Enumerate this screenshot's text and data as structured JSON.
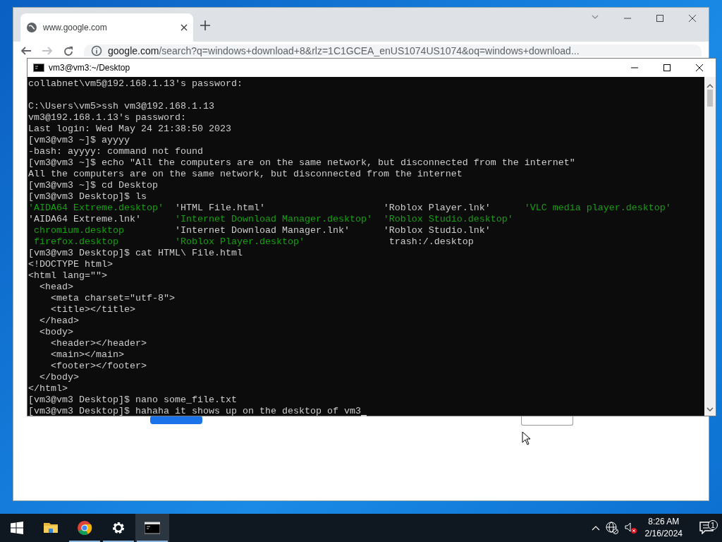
{
  "browser": {
    "tab": {
      "title": "www.google.com"
    },
    "url": {
      "host": "google.com",
      "path": "/search?q=windows+download+8&rlz=1C1GCEA_enUS1074US1074&oq=windows+download..."
    }
  },
  "terminal": {
    "title": "vm3@vm3:~/Desktop",
    "cursor": true,
    "lines": [
      {
        "kind": "text",
        "text": "collabnet\\vm5@192.168.1.13's password:"
      },
      {
        "kind": "blank"
      },
      {
        "kind": "text",
        "text": "C:\\Users\\vm5>ssh vm3@192.168.1.13"
      },
      {
        "kind": "text",
        "text": "vm3@192.168.1.13's password:"
      },
      {
        "kind": "text",
        "text": "Last login: Wed May 24 21:38:50 2023"
      },
      {
        "kind": "text",
        "text": "[vm3@vm3 ~]$ ayyyy"
      },
      {
        "kind": "text",
        "text": "-bash: ayyyy: command not found"
      },
      {
        "kind": "text",
        "text": "[vm3@vm3 ~]$ echo \"All the computers are on the same network, but disconnected from the internet\""
      },
      {
        "kind": "text",
        "text": "All the computers are on the same network, but disconnected from the internet"
      },
      {
        "kind": "text",
        "text": "[vm3@vm3 ~]$ cd Desktop"
      },
      {
        "kind": "text",
        "text": "[vm3@vm3 Desktop]$ ls"
      },
      {
        "kind": "columns",
        "cells": [
          {
            "text": "'AIDA64 Extreme.desktop'",
            "kind": "exec"
          },
          {
            "text": "'HTML File.html'",
            "kind": "file"
          },
          {
            "text": "'Roblox Player.lnk'",
            "kind": "file"
          },
          {
            "text": "'VLC media player.desktop'",
            "kind": "exec"
          }
        ]
      },
      {
        "kind": "columns",
        "cells": [
          {
            "text": "'AIDA64 Extreme.lnk'",
            "kind": "file"
          },
          {
            "text": "'Internet Download Manager.desktop'",
            "kind": "exec"
          },
          {
            "text": "'Roblox Studio.desktop'",
            "kind": "exec"
          }
        ]
      },
      {
        "kind": "columns",
        "cells": [
          {
            "text": " chromium.desktop",
            "kind": "exec"
          },
          {
            "text": "'Internet Download Manager.lnk'",
            "kind": "file"
          },
          {
            "text": "'Roblox Studio.lnk'",
            "kind": "file"
          }
        ]
      },
      {
        "kind": "columns",
        "cells": [
          {
            "text": " firefox.desktop",
            "kind": "exec"
          },
          {
            "text": "'Roblox Player.desktop'",
            "kind": "exec"
          },
          {
            "text": " trash:/.desktop",
            "kind": "file"
          }
        ]
      },
      {
        "kind": "text",
        "text": "[vm3@vm3 Desktop]$ cat HTML\\ File.html"
      },
      {
        "kind": "text",
        "text": "<!DOCTYPE html>"
      },
      {
        "kind": "text",
        "text": "<html lang=\"\">"
      },
      {
        "kind": "text",
        "text": "  <head>"
      },
      {
        "kind": "text",
        "text": "    <meta charset=\"utf-8\">"
      },
      {
        "kind": "text",
        "text": "    <title></title>"
      },
      {
        "kind": "text",
        "text": "  </head>"
      },
      {
        "kind": "text",
        "text": "  <body>"
      },
      {
        "kind": "text",
        "text": "    <header></header>"
      },
      {
        "kind": "text",
        "text": "    <main></main>"
      },
      {
        "kind": "text",
        "text": "    <footer></footer>"
      },
      {
        "kind": "text",
        "text": "  </body>"
      },
      {
        "kind": "text",
        "text": "</html>"
      },
      {
        "kind": "text",
        "text": "[vm3@vm3 Desktop]$ nano some_file.txt"
      },
      {
        "kind": "text",
        "text": "[vm3@vm3 Desktop]$ hahaha it shows up on the desktop of vm3"
      }
    ]
  },
  "taskbar": {
    "apps": [
      {
        "kind": "explorer",
        "running": false,
        "selected": false
      },
      {
        "kind": "chrome",
        "running": true,
        "selected": false
      },
      {
        "kind": "settings",
        "running": true,
        "selected": false
      },
      {
        "kind": "terminal",
        "running": true,
        "selected": true
      }
    ],
    "clock": {
      "time": "8:26 AM",
      "date": "2/16/2024"
    },
    "notifications": {
      "count": "1"
    }
  }
}
